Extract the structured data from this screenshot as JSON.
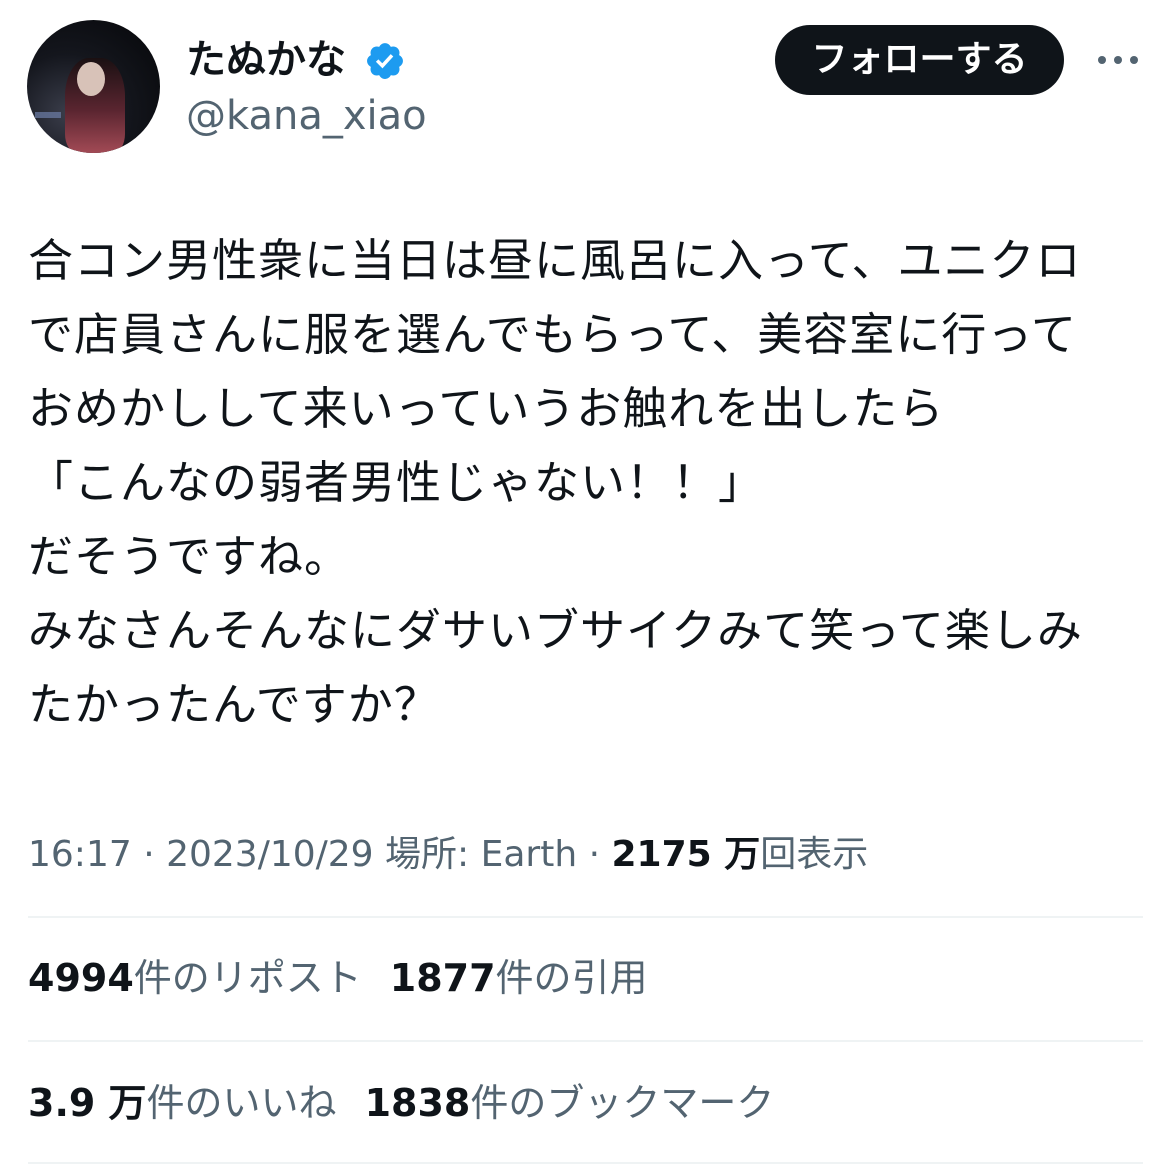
{
  "author": {
    "display_name": "たぬかな",
    "handle": "@kana_xiao",
    "verified": true
  },
  "follow_label": "フォローする",
  "tweet": {
    "text": "合コン男性衆に当日は昼に風呂に入って、ユニクロ\nで店員さんに服を選んでもらって、美容室に行って\nおめかしして来いっていうお触れを出したら\n「こんなの弱者男性じゃない！！」\nだそうですね。\nみなさんそんなにダサいブサイクみて笑って楽しみ\nたかったんですか？"
  },
  "meta": {
    "time": "16:17",
    "sep1": " · ",
    "date": "2023/10/29",
    "location": " 場所: Earth",
    "sep2": " · ",
    "views_count": "2175 万",
    "views_label": "回表示"
  },
  "stats": {
    "reposts": {
      "count": "4994",
      "label": "件のリポスト"
    },
    "quotes": {
      "count": "1877",
      "label": "件の引用"
    },
    "likes": {
      "count": "3.9 万",
      "label": "件のいいね"
    },
    "bookmarks": {
      "count": "1838",
      "label": "件のブックマーク"
    }
  },
  "colors": {
    "text_primary": "#0f1419",
    "text_secondary": "#536471",
    "verified_blue": "#1d9bf0",
    "divider": "#eff3f4"
  },
  "icons": {
    "verified": "verified-badge-icon",
    "more": "more-dots-icon"
  }
}
